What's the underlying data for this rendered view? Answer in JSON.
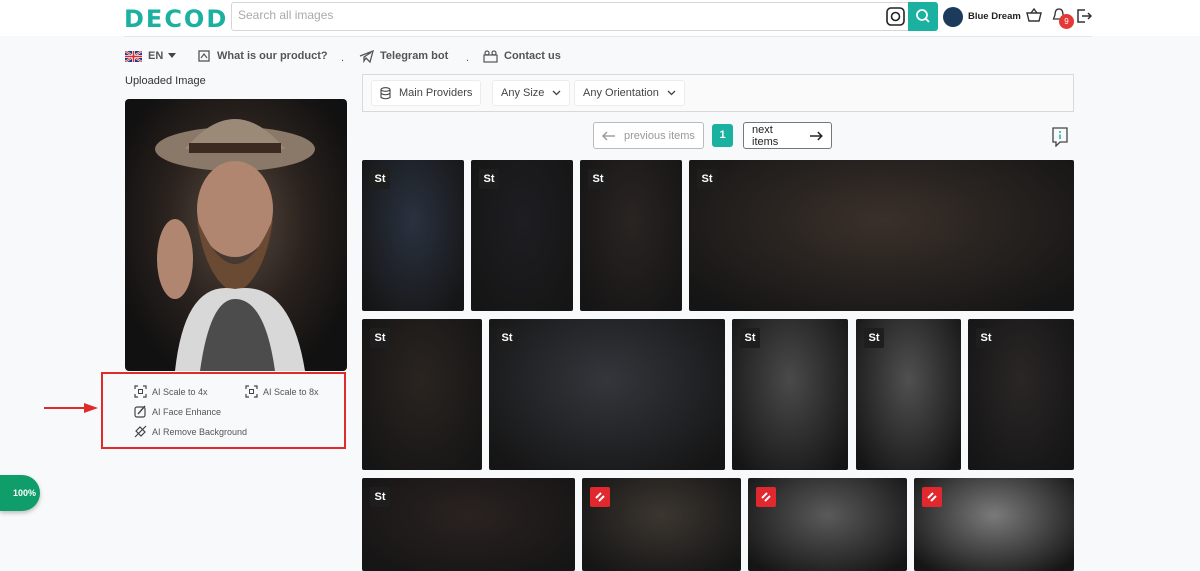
{
  "logo": "DECOD",
  "search": {
    "placeholder": "Search all images"
  },
  "user": {
    "name": "Blue Dream"
  },
  "notifications": {
    "count": "9"
  },
  "nav": {
    "language": "EN",
    "items": [
      "What is our product?",
      "Telegram bot",
      "Contact us"
    ]
  },
  "sidebar": {
    "uploaded_label": "Uploaded Image",
    "ai_options": [
      "AI Scale to 4x",
      "AI Scale to 8x",
      "AI Face Enhance",
      "AI Remove Background"
    ],
    "progress": "100%"
  },
  "filters": {
    "provider": "Main Providers",
    "size": "Any Size",
    "orientation": "Any Orientation"
  },
  "pagination": {
    "previous": "previous items",
    "current": "1",
    "next": "next items"
  },
  "results": {
    "tiles": [
      {
        "tag": "St",
        "color": "#2a3240"
      },
      {
        "tag": "St",
        "color": "#1e1e22"
      },
      {
        "tag": "St",
        "color": "#2a2422"
      },
      {
        "tag": "St",
        "color": "#3a302a"
      },
      {
        "tag": "St",
        "color": "#2a2420"
      },
      {
        "tag": "St",
        "color": "#34363c"
      },
      {
        "tag": "St",
        "color": "#4a4a4a"
      },
      {
        "tag": "St",
        "color": "#505050"
      },
      {
        "tag": "St",
        "color": "#2a2626"
      },
      {
        "tag": "St",
        "color": "#2a2220"
      },
      {
        "tag": "",
        "color": "#3c3630"
      },
      {
        "tag": "",
        "color": "#5a5a5a"
      },
      {
        "tag": "",
        "color": "#7a7a7a"
      }
    ]
  },
  "colors": {
    "accent": "#1ab1a1",
    "highlight": "#e02b2b",
    "badge": "#e53935"
  }
}
